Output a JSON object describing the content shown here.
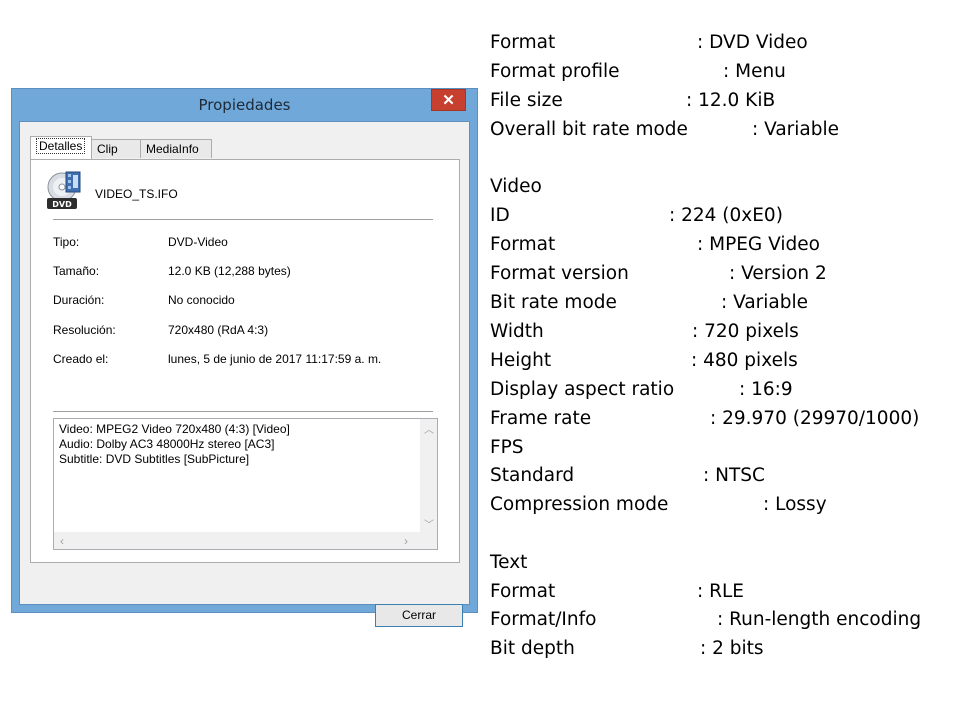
{
  "dialog": {
    "title": "Propiedades",
    "close_glyph": "✕",
    "tabs": [
      {
        "label": "Detalles",
        "active": true
      },
      {
        "label": "Clip",
        "active": false
      },
      {
        "label": "MediaInfo",
        "active": false
      }
    ],
    "file": {
      "icon": "dvd-file-icon",
      "icon_label": "DVD",
      "name": "VIDEO_TS.IFO"
    },
    "properties": [
      {
        "label": "Tipo:",
        "value": "DVD-Video"
      },
      {
        "label": "Tamaño:",
        "value": "12.0 KB (12,288 bytes)"
      },
      {
        "label": "Duración:",
        "value": "No conocido"
      },
      {
        "label": "Resolución:",
        "value": "720x480 (RdA 4:3)"
      },
      {
        "label": "Creado el:",
        "value": "lunes, 5 de junio de 2017 11:17:59 a. m."
      }
    ],
    "media_lines": [
      "Video: MPEG2 Video 720x480 (4:3) [Video]",
      "Audio: Dolby AC3 48000Hz stereo [AC3]",
      "Subtitle: DVD Subtitles [SubPicture]"
    ],
    "cerrar_label": "Cerrar"
  },
  "mediainfo": {
    "general": [
      {
        "key": "Format",
        "value": ": DVD Video"
      },
      {
        "key": "Format profile",
        "value": ": Menu"
      },
      {
        "key": "File size",
        "value": ": 12.0 KiB"
      },
      {
        "key": "Overall bit rate mode",
        "value": ": Variable"
      }
    ],
    "video_heading": "Video",
    "video": [
      {
        "key": "ID",
        "value": ": 224 (0xE0)"
      },
      {
        "key": "Format",
        "value": ": MPEG Video"
      },
      {
        "key": "Format version",
        "value": ": Version 2"
      },
      {
        "key": "Bit rate mode",
        "value": ": Variable"
      },
      {
        "key": "Width",
        "value": ": 720 pixels"
      },
      {
        "key": "Height",
        "value": ": 480 pixels"
      },
      {
        "key": "Display aspect ratio",
        "value": ": 16:9"
      },
      {
        "key": "Frame rate",
        "value": ": 29.970 (29970/1000)"
      },
      {
        "key": "FPS",
        "value": ""
      },
      {
        "key": "Standard",
        "value": ": NTSC"
      },
      {
        "key": "Compression mode",
        "value": ": Lossy"
      }
    ],
    "text_heading": "Text",
    "text": [
      {
        "key": "Format",
        "value": ": RLE"
      },
      {
        "key": "Format/Info",
        "value": ": Run-length encoding"
      },
      {
        "key": "Bit depth",
        "value": ": 2 bits"
      }
    ]
  },
  "colors": {
    "title_bar": "#6fa8d9",
    "close_button": "#c7402f",
    "button_border": "#3c7fb1"
  }
}
